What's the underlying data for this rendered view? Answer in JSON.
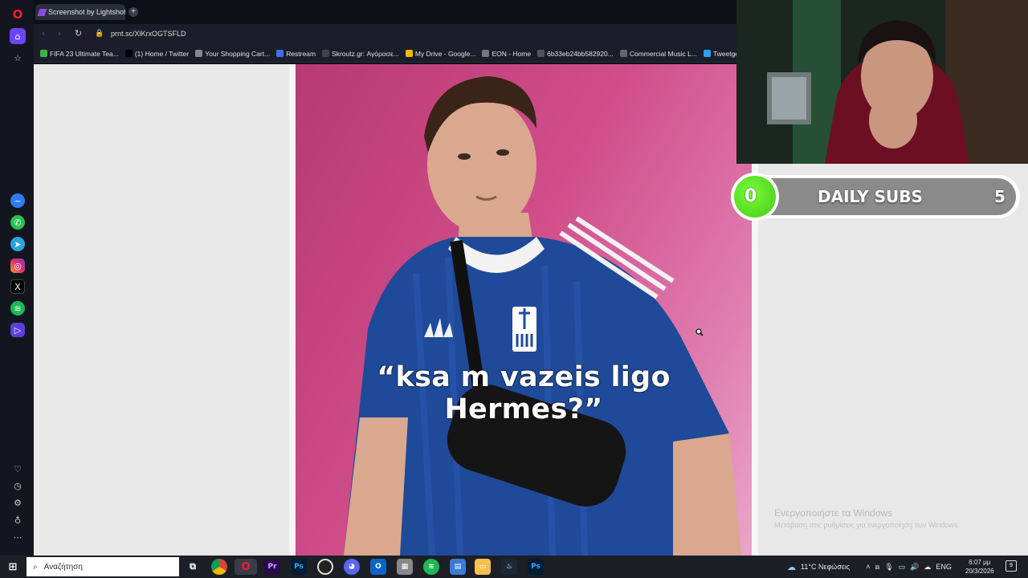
{
  "browser": {
    "tab_title": "Screenshot by Lightshot",
    "new_tab": "+",
    "url": "prnt.sc/XlKrxOGTSFLD",
    "bookmarks": [
      {
        "label": "FIFA 23 Ultimate Tea...",
        "color": "#3bb54a"
      },
      {
        "label": "(1) Home / Twitter",
        "color": "#000000"
      },
      {
        "label": "Your Shopping Cart...",
        "color": "#888888"
      },
      {
        "label": "Restream",
        "color": "#3b6ff5"
      },
      {
        "label": "Skroutz.gr: Αγόρασε...",
        "color": "#444444"
      },
      {
        "label": "My Drive - Google...",
        "color": "#f2b900"
      },
      {
        "label": "EON - Home",
        "color": "#777777"
      },
      {
        "label": "6b33eb24bb582920...",
        "color": "#555555"
      },
      {
        "label": "Commercial Music L...",
        "color": "#666666"
      },
      {
        "label": "Tweetgen -",
        "color": "#2aa0f0"
      }
    ]
  },
  "sidebar": {
    "icons": [
      "opera-logo-icon",
      "home-icon",
      "star-icon",
      "messenger-icon",
      "whatsapp-icon",
      "telegram-icon",
      "instagram-icon",
      "x-icon",
      "spotify-icon",
      "player-icon",
      "heart-icon",
      "history-icon",
      "settings-icon",
      "lightbulb-icon",
      "more-icon"
    ]
  },
  "content": {
    "caption": "“ksa m vazeis ligo Hermes?”"
  },
  "overlay": {
    "current": "0",
    "label": "DAILY SUBS",
    "goal": "5",
    "current_fraction": 0
  },
  "watermark": {
    "title": "Ενεργοποιήστε τα Windows",
    "subtitle": "Μετάβαση στις ρυθμίσεις για ενεργοποίηση των Windows."
  },
  "taskbar": {
    "search_placeholder": "Αναζήτηση",
    "apps": [
      "task-view",
      "chrome",
      "opera",
      "premiere",
      "photoshop",
      "obs",
      "discord",
      "outlook",
      "app",
      "spotify",
      "app2",
      "explorer",
      "steam",
      "photoshop2"
    ],
    "weather": "11°C  Νεφώσεις",
    "lang": "ENG",
    "time": "6:07 μμ",
    "date": "20/3/2026",
    "notifications": "9"
  },
  "colors": {
    "accent": "#ff1b2d",
    "green": "#4fd820",
    "pink": "#d04d8a",
    "jersey": "#1f4a9a"
  }
}
